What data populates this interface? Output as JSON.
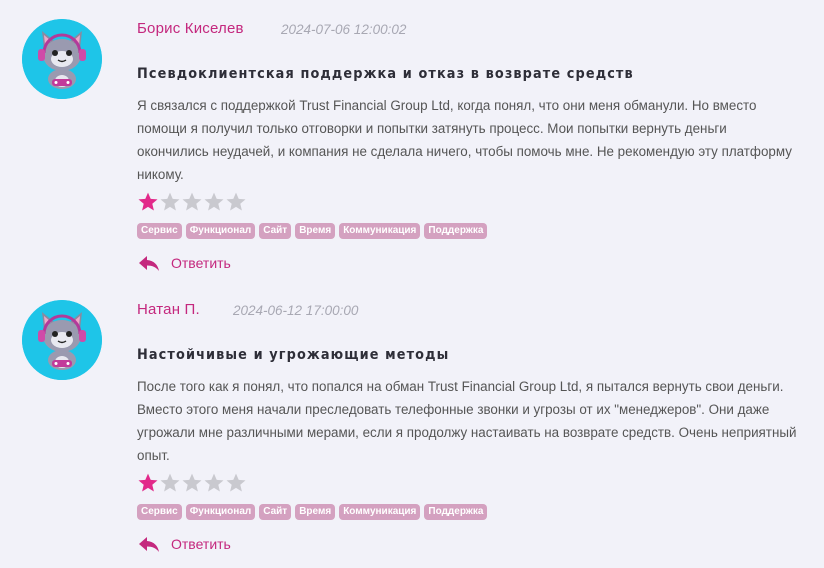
{
  "reviews": [
    {
      "author": "Борис Киселев",
      "date": "2024-07-06 12:00:02",
      "title": "Псевдоклиентская поддержка и отказ в возврате средств",
      "text": "Я связался с поддержкой Trust Financial Group Ltd, когда понял, что они меня обманули. Но вместо помощи я получил только отговорки и попытки затянуть процесс. Мои попытки вернуть деньги окончились неудачей, и компания не сделала ничего, чтобы помочь мне. Не рекомендую эту платформу никому.",
      "rating": 1,
      "rating_max": 5,
      "tags": [
        "Сервис",
        "Функционал",
        "Сайт",
        "Время",
        "Коммуникация",
        "Поддержка"
      ],
      "reply_label": "Ответить"
    },
    {
      "author": "Натан П.",
      "date": "2024-06-12 17:00:00",
      "title": "Настойчивые и угрожающие методы",
      "text": "После того как я понял, что попался на обман Trust Financial Group Ltd, я пытался вернуть свои деньги. Вместо этого меня начали преследовать телефонные звонки и угрозы от их \"менеджеров\". Они даже угрожали мне различными мерами, если я продолжу настаивать на возврате средств. Очень неприятный опыт.",
      "rating": 1,
      "rating_max": 5,
      "tags": [
        "Сервис",
        "Функционал",
        "Сайт",
        "Время",
        "Коммуникация",
        "Поддержка"
      ],
      "reply_label": "Ответить"
    }
  ],
  "icons": {
    "avatar": "gamer-cat-avatar",
    "star": "star-icon",
    "reply": "reply-arrow-icon"
  },
  "colors": {
    "accent": "#c4287e",
    "star_filled": "#e2298a",
    "star_empty": "#c9c9cf",
    "tag_bg": "#d4a1c0",
    "avatar_bg": "#1ec5e8",
    "page_bg": "#f2f2f9"
  }
}
